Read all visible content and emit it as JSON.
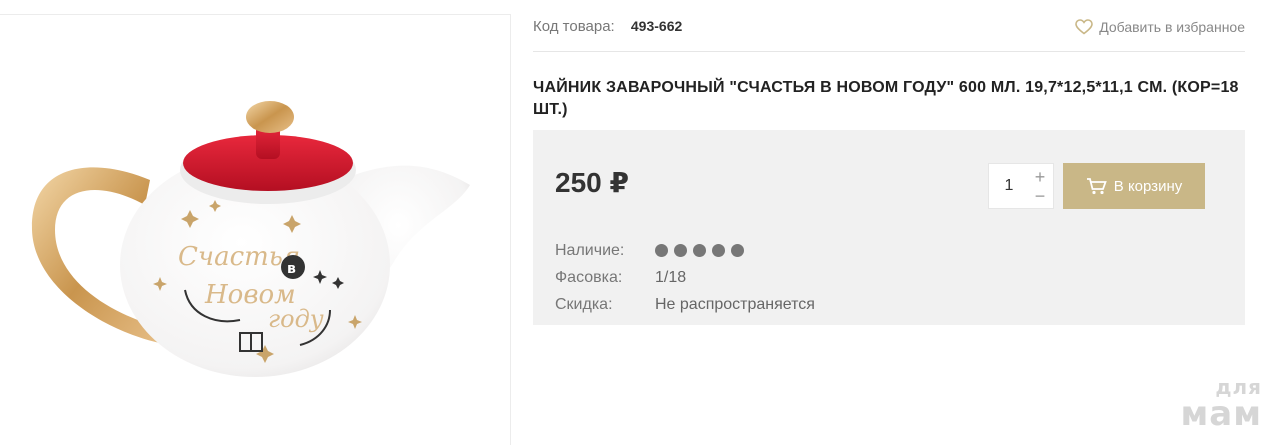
{
  "product": {
    "sku_label": "Код товара:",
    "sku_value": "493-662",
    "favorite_label": "Добавить в избранное",
    "title": "ЧАЙНИК ЗАВАРОЧНЫЙ \"СЧАСТЬЯ В НОВОМ ГОДУ\" 600 МЛ. 19,7*12,5*11,1 СМ. (КОР=18 ШТ.)",
    "image_text": [
      "Счастья",
      "в",
      "Новом",
      "году"
    ]
  },
  "buy": {
    "price": "250 ₽",
    "quantity": "1",
    "plus": "+",
    "minus": "−",
    "cart_label": "В корзину"
  },
  "props": {
    "availability_label": "Наличие:",
    "availability_level": 5,
    "availability_max": 5,
    "packing_label": "Фасовка:",
    "packing_value": "1/18",
    "discount_label": "Скидка:",
    "discount_value": "Не распространяется"
  },
  "watermark": {
    "top": "для",
    "bottom": "мам"
  },
  "colors": {
    "accent": "#c9b787",
    "panel": "#f1f1f1",
    "lid": "#d4152a",
    "gold": "#c9a46a"
  },
  "icons": [
    "heart-outline-icon",
    "cart-icon"
  ]
}
